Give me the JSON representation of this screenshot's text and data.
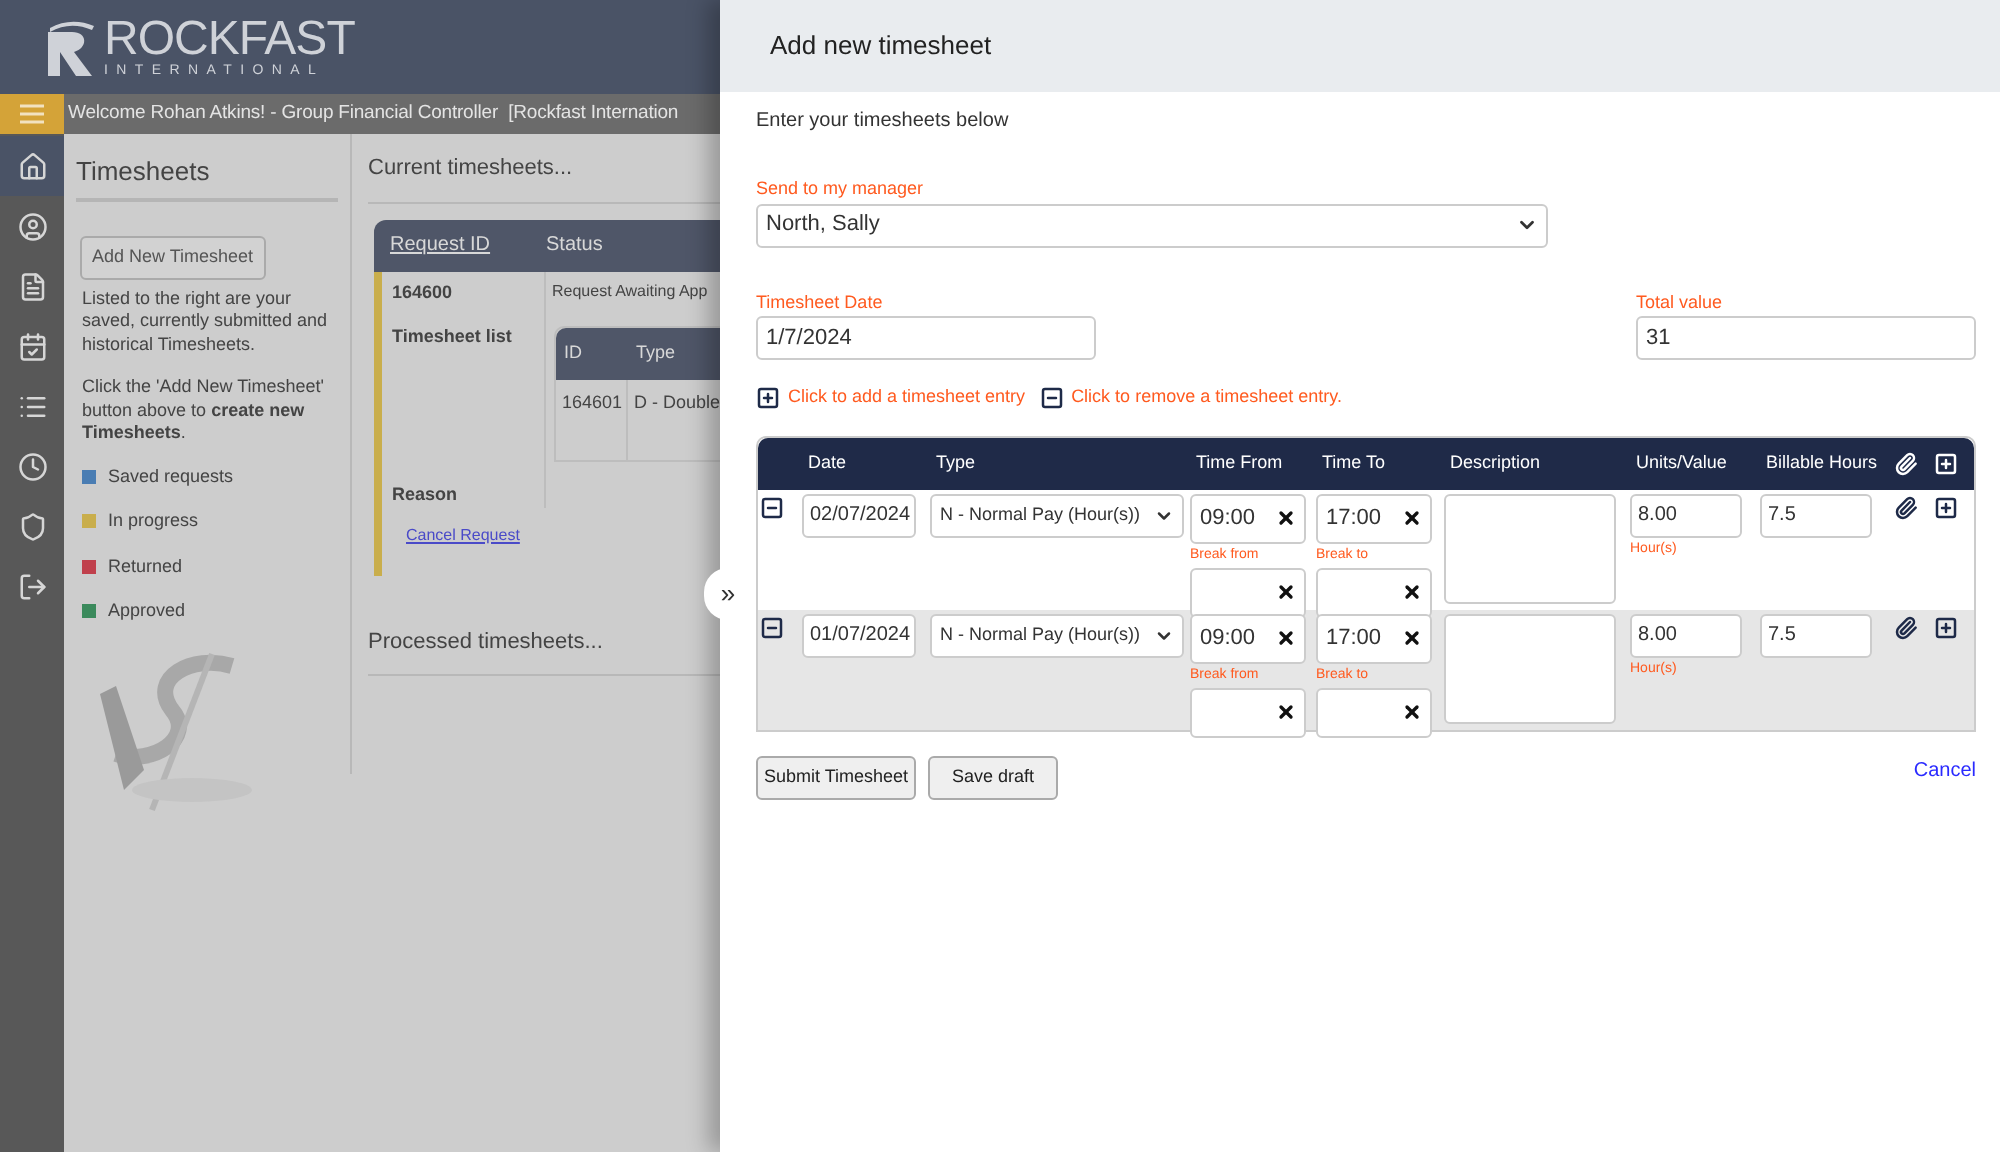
{
  "logo": {
    "name": "ROCKFAST",
    "tagline": "INTERNATIONAL"
  },
  "welcome": "Welcome Rohan Atkins! - Group Financial Controller  [Rockfast Internation",
  "nav": [
    {
      "kind": "home",
      "selected": true
    },
    {
      "kind": "profile",
      "selected": false
    },
    {
      "kind": "document",
      "selected": false
    },
    {
      "kind": "calendar",
      "selected": false
    },
    {
      "kind": "list",
      "selected": false
    },
    {
      "kind": "clock",
      "selected": false
    },
    {
      "kind": "shield",
      "selected": false
    },
    {
      "kind": "logout",
      "selected": false
    }
  ],
  "sidebar": {
    "title": "Timesheets",
    "add_button": "Add New Timesheet",
    "intro": "Listed to the right are your saved, currently submitted and historical Timesheets.",
    "hint": "Click the 'Add New Timesheet' button above to **create new Timesheets**.",
    "legend": [
      {
        "label": "Saved requests",
        "color": "#4a7db3"
      },
      {
        "label": "In progress",
        "color": "#c9ae4c"
      },
      {
        "label": "Returned",
        "color": "#c0404c"
      },
      {
        "label": "Approved",
        "color": "#3b8a5c"
      }
    ]
  },
  "current": {
    "title": "Current timesheets...",
    "columns": [
      "Request ID",
      "Status"
    ],
    "request": {
      "id": "164600",
      "status": "Request Awaiting App",
      "list_label": "Timesheet list",
      "list_columns": [
        "ID",
        "Type"
      ],
      "list_rows": [
        [
          "164601",
          "D - Double"
        ]
      ],
      "reason_label": "Reason",
      "cancel_link": "Cancel Request"
    }
  },
  "processed": {
    "title": "Processed timesheets..."
  },
  "toggle": "»",
  "drawer": {
    "title": "Add new timesheet",
    "intro": "Enter your timesheets below",
    "manager": {
      "label": "Send to my manager",
      "value": "North, Sally"
    },
    "date": {
      "label": "Timesheet Date",
      "value": "1/7/2024"
    },
    "total": {
      "label": "Total value",
      "value": "31"
    },
    "add_hint": "Click to add a timesheet entry",
    "remove_hint": "Click to remove a timesheet entry.",
    "columns": [
      "Date",
      "Type",
      "Time From",
      "Time To",
      "Description",
      "Units/Value",
      "Billable Hours"
    ],
    "entries": [
      {
        "date": "02/07/2024",
        "type": "N - Normal Pay (Hour(s))",
        "time_from": "09:00",
        "time_to": "17:00",
        "break_from_label": "Break from",
        "break_to_label": "Break to",
        "units": "8.00",
        "units_label": "Hour(s)",
        "billable": "7.5"
      },
      {
        "date": "01/07/2024",
        "type": "N - Normal Pay (Hour(s))",
        "time_from": "09:00",
        "time_to": "17:00",
        "break_from_label": "Break from",
        "break_to_label": "Break to",
        "units": "8.00",
        "units_label": "Hour(s)",
        "billable": "7.5"
      }
    ],
    "buttons": [
      "Submit Timesheet",
      "Save draft"
    ],
    "cancel": "Cancel"
  }
}
